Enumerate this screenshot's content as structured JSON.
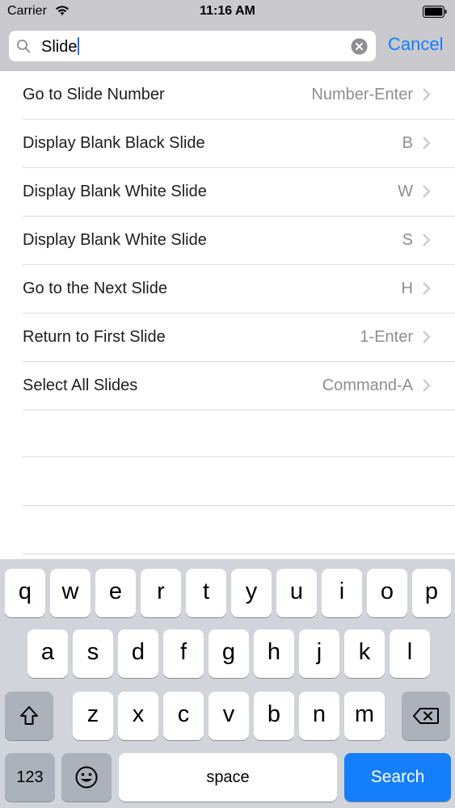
{
  "status_bar": {
    "carrier": "Carrier",
    "time": "11:16 AM",
    "wifi_icon": "wifi-icon",
    "battery_icon": "battery-icon"
  },
  "search": {
    "value": "Slide",
    "clear_icon": "clear-icon",
    "cancel_label": "Cancel"
  },
  "results": [
    {
      "label": "Go to Slide Number",
      "shortcut": "Number-Enter"
    },
    {
      "label": "Display Blank Black Slide",
      "shortcut": "B"
    },
    {
      "label": "Display Blank White Slide",
      "shortcut": "W"
    },
    {
      "label": "Display Blank White Slide",
      "shortcut": "S"
    },
    {
      "label": "Go to the Next Slide",
      "shortcut": "H"
    },
    {
      "label": "Return to First Slide",
      "shortcut": "1-Enter"
    },
    {
      "label": "Select All Slides",
      "shortcut": "Command-A"
    }
  ],
  "keyboard": {
    "row1": [
      "q",
      "w",
      "e",
      "r",
      "t",
      "y",
      "u",
      "i",
      "o",
      "p"
    ],
    "row2": [
      "a",
      "s",
      "d",
      "f",
      "g",
      "h",
      "j",
      "k",
      "l"
    ],
    "row3": [
      "z",
      "x",
      "c",
      "v",
      "b",
      "n",
      "m"
    ],
    "numbers_label": "123",
    "space_label": "space",
    "search_label": "Search",
    "shift_icon": "shift-icon",
    "delete_icon": "delete-icon",
    "emoji_icon": "emoji-icon",
    "accent_color": "#157efb"
  }
}
